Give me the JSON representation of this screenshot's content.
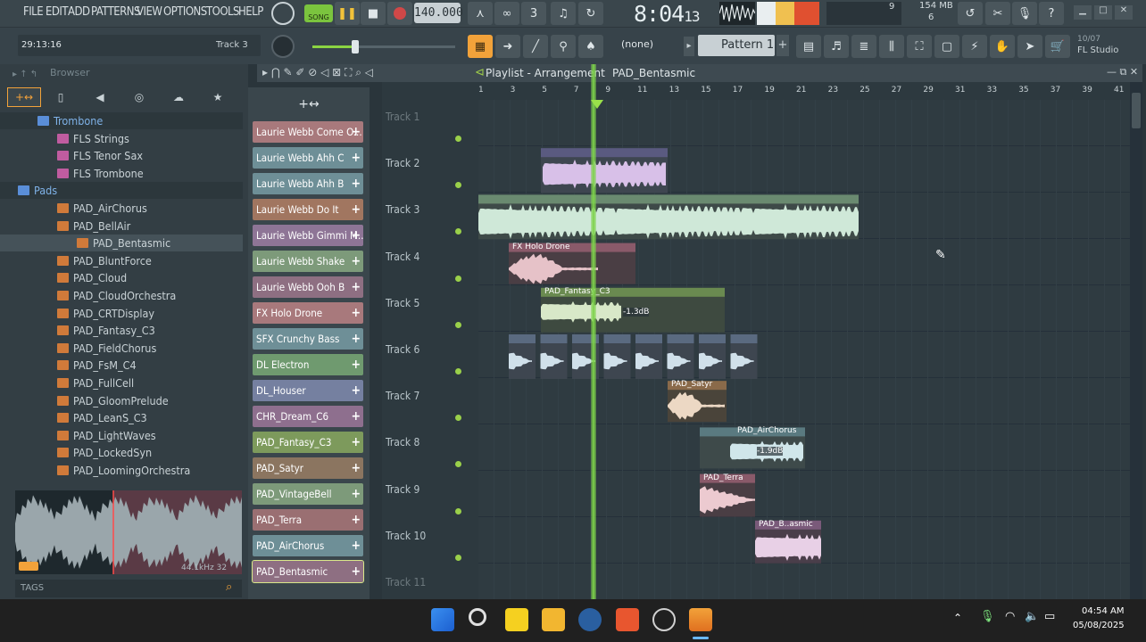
{
  "menu": [
    "FILE",
    "EDIT",
    "ADD",
    "PATTERNS",
    "VIEW",
    "OPTIONS",
    "TOOLS",
    "HELP"
  ],
  "transport": {
    "song_label": "SONG",
    "tempo": "140.000",
    "clock_main": "8:04",
    "clock_sub": "13",
    "cpu_value": "9",
    "mem_value": "154 MB",
    "mem_sub": "6"
  },
  "toolbar2": {
    "time": "29:13:16",
    "track_hint": "Track 3",
    "pattern_none": "(none)",
    "pattern_name": "Pattern 1",
    "news_date": "10/07",
    "news_text": "FL Studio"
  },
  "browser": {
    "title": "Browser",
    "waveform_info": "44.1kHz 32",
    "tags_label": "TAGS",
    "items": [
      {
        "label": "Trombone",
        "kind": "folder",
        "indent": 1
      },
      {
        "label": "FLS Strings",
        "kind": "fls",
        "indent": 2
      },
      {
        "label": "FLS Tenor Sax",
        "kind": "fls",
        "indent": 2
      },
      {
        "label": "FLS Trombone",
        "kind": "fls",
        "indent": 2
      },
      {
        "label": "Pads",
        "kind": "folder",
        "indent": 0
      },
      {
        "label": "PAD_AirChorus",
        "kind": "pad",
        "indent": 2
      },
      {
        "label": "PAD_BellAir",
        "kind": "pad",
        "indent": 2
      },
      {
        "label": "PAD_Bentasmic",
        "kind": "pad",
        "indent": 3,
        "selected": true
      },
      {
        "label": "PAD_BluntForce",
        "kind": "pad",
        "indent": 2
      },
      {
        "label": "PAD_Cloud",
        "kind": "pad",
        "indent": 2
      },
      {
        "label": "PAD_CloudOrchestra",
        "kind": "pad",
        "indent": 2
      },
      {
        "label": "PAD_CRTDisplay",
        "kind": "pad",
        "indent": 2
      },
      {
        "label": "PAD_Fantasy_C3",
        "kind": "pad",
        "indent": 2
      },
      {
        "label": "PAD_FieldChorus",
        "kind": "pad",
        "indent": 2
      },
      {
        "label": "PAD_FsM_C4",
        "kind": "pad",
        "indent": 2
      },
      {
        "label": "PAD_FullCell",
        "kind": "pad",
        "indent": 2
      },
      {
        "label": "PAD_GloomPrelude",
        "kind": "pad",
        "indent": 2
      },
      {
        "label": "PAD_LeanS_C3",
        "kind": "pad",
        "indent": 2
      },
      {
        "label": "PAD_LightWaves",
        "kind": "pad",
        "indent": 2
      },
      {
        "label": "PAD_LockedSyn",
        "kind": "pad",
        "indent": 2
      },
      {
        "label": "PAD_LoomingOrchestra",
        "kind": "pad",
        "indent": 2
      }
    ]
  },
  "channels": [
    {
      "label": "Laurie Webb Come O...",
      "color": "#a8797c"
    },
    {
      "label": "Laurie Webb Ahh C",
      "color": "#6e8f97"
    },
    {
      "label": "Laurie Webb Ahh B",
      "color": "#6e8f97"
    },
    {
      "label": "Laurie Webb Do It",
      "color": "#a17660"
    },
    {
      "label": "Laurie Webb Gimmi M...",
      "color": "#8e7596"
    },
    {
      "label": "Laurie Webb Shake",
      "color": "#7d9a7a"
    },
    {
      "label": "Laurie Webb Ooh B",
      "color": "#8e6f82"
    },
    {
      "label": "FX Holo Drone",
      "color": "#a8797c"
    },
    {
      "label": "SFX Crunchy Bass",
      "color": "#6e8f97"
    },
    {
      "label": "DL Electron",
      "color": "#6f9a6f"
    },
    {
      "label": "DL_Houser",
      "color": "#7580a0"
    },
    {
      "label": "CHR_Dream_C6",
      "color": "#8e6f8e"
    },
    {
      "label": "PAD_Fantasy_C3",
      "color": "#7d9a5c"
    },
    {
      "label": "PAD_Satyr",
      "color": "#8b7560"
    },
    {
      "label": "PAD_VintageBell",
      "color": "#7d9a7a"
    },
    {
      "label": "PAD_Terra",
      "color": "#9a6f72"
    },
    {
      "label": "PAD_AirChorus",
      "color": "#6e8f97"
    },
    {
      "label": "PAD_Bentasmic",
      "color": "#8e6f82"
    }
  ],
  "playlist": {
    "title": "Playlist - Arrangement",
    "pattern": "PAD_Bentasmic",
    "ruler": [
      "1",
      "3",
      "5",
      "7",
      "9",
      "11",
      "13",
      "15",
      "17",
      "19",
      "21",
      "23",
      "25",
      "27",
      "29",
      "31",
      "33",
      "35",
      "37",
      "39",
      "41"
    ],
    "tracks": [
      "Track 1",
      "Track 2",
      "Track 3",
      "Track 4",
      "Track 5",
      "Track 6",
      "Track 7",
      "Track 8",
      "Track 9",
      "Track 10",
      "Track 11"
    ],
    "clips": [
      {
        "name": "FX Holo Drone",
        "track": 4
      },
      {
        "name": "PAD_Fantasy_C3",
        "track": 5,
        "gain": "-1.3dB"
      },
      {
        "name": "PAD_Satyr",
        "track": 7
      },
      {
        "name": "PAD_AirChorus",
        "track": 8,
        "gain": "-1.9dB"
      },
      {
        "name": "PAD_Terra",
        "track": 9
      },
      {
        "name": "PAD_B..asmic",
        "track": 10
      }
    ]
  },
  "tray": {
    "time": "04:54 AM",
    "date": "05/08/2025"
  },
  "colors": {
    "playhead": "#7dd34a",
    "accent": "#f2a23a"
  }
}
